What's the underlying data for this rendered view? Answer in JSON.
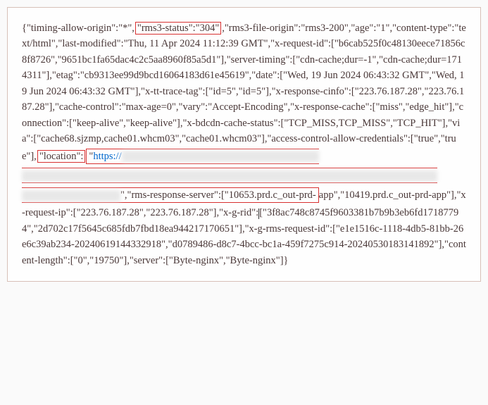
{
  "json_display": {
    "open": "{\"timing-allow-origin\":\"*\",",
    "rms3_status_box": "\"rms3-status\":\"304\"",
    "seg1": ",\"rms3-file-origin\":\"rms3-200\",\"age\":\"1\",\"content-type\":\"text/html\",\"last-modified\":\"Thu, 11 Apr 2024 11:12:39 GMT\",\"x-request-id\":[\"b6cab525f0c48130eece71856c8f8726\",\"9651bc1fa65dac4c2c5aa8960f85a5d1\"],\"server-timing\":[\"cdn-cache;dur=-1\",\"cdn-cache;dur=1714311\"],\"etag\":\"cb9313ee99d9bcd16064183d61e45619\",\"date\":[\"Wed, 19 Jun 2024 06:43:32 GMT\",\"Wed, 19 Jun 2024 06:43:32 GMT\"],\"x-tt-trace-tag\":[\"id=5\",\"id=5\"],\"x-response-cinfo\":[\"223.76.187.28\",\"223.76.187.28\"],\"cache-control\":\"max-age=0\",\"vary\":\"Accept-Encoding\",\"x-response-cache\":[\"miss\",\"edge_hit\"],\"connection\":[\"keep-alive\",\"keep-alive\"],\"x-bdcdn-cache-status\":[\"TCP_MISS,TCP_MISS\",\"TCP_HIT\"],\"via\":[\"cache68.sjzmp,cache01.whcm03\",\"cache01.whcm03\"],\"access-control-allow-credentials\":[\"true\",\"true\"],",
    "location_box_key": "\"location\":",
    "location_box_val_prefix": "\"",
    "location_url_visible": "https://",
    "location_box_val_suffix": "\",\"rms-response-server\":[\"10653.prd.c_out-prd-",
    "seg2": "app\",\"10419.prd.c_out-prd-app\"],\"x-request-ip\":[\"223.76.187.28\",\"223.76.187.28\"],\"x-g-rid\":",
    "seg3": "[\"3f8ac748c8745f9603381b7b9b3eb6fd17187794\",\"2d702c17f5645c685fdb7fbd18ea944217170651\"],\"x-g-rms-request-id\":[\"e1e1516c-1118-4db5-81bb-26e6c39ab234-20240619144332918\",\"d0789486-d8c7-4bcc-bc1a-459f7275c914-20240530183141892\"],\"content-length\":[\"0\",\"19750\"],\"server\":[\"Byte-nginx\",\"Byte-nginx\"]}"
  },
  "chart_data": {
    "type": "table",
    "title": "HTTP Response Headers (JSON)",
    "highlighted_keys": [
      "rms3-status",
      "location"
    ],
    "headers": {
      "timing-allow-origin": "*",
      "rms3-status": "304",
      "rms3-file-origin": "rms3-200",
      "age": "1",
      "content-type": "text/html",
      "last-modified": "Thu, 11 Apr 2024 11:12:39 GMT",
      "x-request-id": [
        "b6cab525f0c48130eece71856c8f8726",
        "9651bc1fa65dac4c2c5aa8960f85a5d1"
      ],
      "server-timing": [
        "cdn-cache;dur=-1",
        "cdn-cache;dur=1714311"
      ],
      "etag": "cb9313ee99d9bcd16064183d61e45619",
      "date": [
        "Wed, 19 Jun 2024 06:43:32 GMT",
        "Wed, 19 Jun 2024 06:43:32 GMT"
      ],
      "x-tt-trace-tag": [
        "id=5",
        "id=5"
      ],
      "x-response-cinfo": [
        "223.76.187.28",
        "223.76.187.28"
      ],
      "cache-control": "max-age=0",
      "vary": "Accept-Encoding",
      "x-response-cache": [
        "miss",
        "edge_hit"
      ],
      "connection": [
        "keep-alive",
        "keep-alive"
      ],
      "x-bdcdn-cache-status": [
        "TCP_MISS,TCP_MISS",
        "TCP_HIT"
      ],
      "via": [
        "cache68.sjzmp,cache01.whcm03",
        "cache01.whcm03"
      ],
      "access-control-allow-credentials": [
        "true",
        "true"
      ],
      "location": "https://[redacted]",
      "rms-response-server": [
        "10653.prd.c_out-prd-app",
        "10419.prd.c_out-prd-app"
      ],
      "x-request-ip": [
        "223.76.187.28",
        "223.76.187.28"
      ],
      "x-g-rid": [
        "3f8ac748c8745f9603381b7b9b3eb6fd17187794",
        "2d702c17f5645c685fdb7fbd18ea944217170651"
      ],
      "x-g-rms-request-id": [
        "e1e1516c-1118-4db5-81bb-26e6c39ab234-20240619144332918",
        "d0789486-d8c7-4bcc-bc1a-459f7275c914-20240530183141892"
      ],
      "content-length": [
        "0",
        "19750"
      ],
      "server": [
        "Byte-nginx",
        "Byte-nginx"
      ]
    }
  }
}
